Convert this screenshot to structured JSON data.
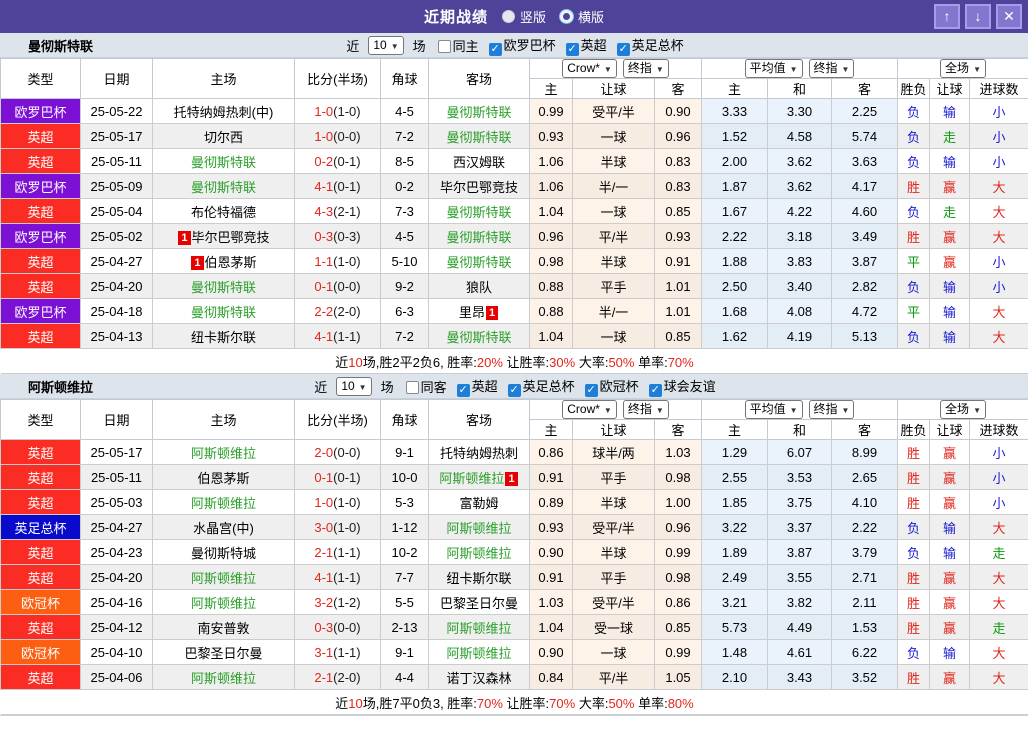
{
  "titlebar": {
    "title": "近期战绩",
    "radio_vertical": "竖版",
    "radio_horizontal": "横版",
    "icons": {
      "up": "↑",
      "down": "↓",
      "close": "✕"
    }
  },
  "accent_colors": {
    "titlebar_bg": "#4e4399",
    "button_bg": "#8376cf",
    "checkbox_blue": "#1d7fd8",
    "focus_team_green": "#2a9f2a",
    "score_red": "#e0261d"
  },
  "league_colors": {
    "欧罗巴杯": "#7c10d4",
    "英超": "#fa2c23",
    "英足总杯": "#0a0acd",
    "欧冠杯": "#fc5f11"
  },
  "result_colors": {
    "胜": "#e0261d",
    "赢": "#e0261d",
    "大": "#e0261d",
    "负": "#1a1ad0",
    "输": "#1a1ad0",
    "小": "#1a1ad0",
    "平": "#0a9a0a",
    "走": "#0a9a0a"
  },
  "table": {
    "headers": {
      "type": "类型",
      "date": "日期",
      "home": "主场",
      "score": "比分(半场)",
      "corner": "角球",
      "away": "客场",
      "bookmaker_select": "Crow*",
      "final_index_select1": "终指",
      "avg_select": "平均值",
      "final_index_select2": "终指",
      "scope_select": "全场",
      "sub": [
        "主",
        "让球",
        "客",
        "主",
        "和",
        "客",
        "胜负",
        "让球",
        "进球数"
      ]
    },
    "card_badge": "1"
  },
  "filter_labels": {
    "near": "近",
    "matches": "场",
    "count_value": "10"
  },
  "sections": [
    {
      "team": "曼彻斯特联",
      "filters": [
        {
          "label": "同主",
          "checked": false
        },
        {
          "label": "欧罗巴杯",
          "checked": true
        },
        {
          "label": "英超",
          "checked": true
        },
        {
          "label": "英足总杯",
          "checked": true
        }
      ],
      "rows": [
        {
          "league": "欧罗巴杯",
          "date": "25-05-22",
          "home": "托特纳姆热刺(中)",
          "home_focus": false,
          "home_card": "",
          "score": "1-0",
          "half": "(1-0)",
          "corner": "4-5",
          "away": "曼彻斯特联",
          "away_focus": true,
          "away_card": "",
          "h_home": "0.99",
          "handicap": "受平/半",
          "h_away": "0.90",
          "a_home": "3.33",
          "a_draw": "3.30",
          "a_away": "2.25",
          "res_wdl": "负",
          "res_handicap": "输",
          "res_goals": "小"
        },
        {
          "league": "英超",
          "date": "25-05-17",
          "home": "切尔西",
          "home_focus": false,
          "home_card": "",
          "score": "1-0",
          "half": "(0-0)",
          "corner": "7-2",
          "away": "曼彻斯特联",
          "away_focus": true,
          "away_card": "",
          "h_home": "0.93",
          "handicap": "一球",
          "h_away": "0.96",
          "a_home": "1.52",
          "a_draw": "4.58",
          "a_away": "5.74",
          "res_wdl": "负",
          "res_handicap": "走",
          "res_goals": "小"
        },
        {
          "league": "英超",
          "date": "25-05-11",
          "home": "曼彻斯特联",
          "home_focus": true,
          "home_card": "",
          "score": "0-2",
          "half": "(0-1)",
          "corner": "8-5",
          "away": "西汉姆联",
          "away_focus": false,
          "away_card": "",
          "h_home": "1.06",
          "handicap": "半球",
          "h_away": "0.83",
          "a_home": "2.00",
          "a_draw": "3.62",
          "a_away": "3.63",
          "res_wdl": "负",
          "res_handicap": "输",
          "res_goals": "小"
        },
        {
          "league": "欧罗巴杯",
          "date": "25-05-09",
          "home": "曼彻斯特联",
          "home_focus": true,
          "home_card": "",
          "score": "4-1",
          "half": "(0-1)",
          "corner": "0-2",
          "away": "毕尔巴鄂竞技",
          "away_focus": false,
          "away_card": "",
          "h_home": "1.06",
          "handicap": "半/一",
          "h_away": "0.83",
          "a_home": "1.87",
          "a_draw": "3.62",
          "a_away": "4.17",
          "res_wdl": "胜",
          "res_handicap": "赢",
          "res_goals": "大"
        },
        {
          "league": "英超",
          "date": "25-05-04",
          "home": "布伦特福德",
          "home_focus": false,
          "home_card": "",
          "score": "4-3",
          "half": "(2-1)",
          "corner": "7-3",
          "away": "曼彻斯特联",
          "away_focus": true,
          "away_card": "",
          "h_home": "1.04",
          "handicap": "一球",
          "h_away": "0.85",
          "a_home": "1.67",
          "a_draw": "4.22",
          "a_away": "4.60",
          "res_wdl": "负",
          "res_handicap": "走",
          "res_goals": "大"
        },
        {
          "league": "欧罗巴杯",
          "date": "25-05-02",
          "home": "毕尔巴鄂竞技",
          "home_focus": false,
          "home_card": "pre",
          "score": "0-3",
          "half": "(0-3)",
          "corner": "4-5",
          "away": "曼彻斯特联",
          "away_focus": true,
          "away_card": "",
          "h_home": "0.96",
          "handicap": "平/半",
          "h_away": "0.93",
          "a_home": "2.22",
          "a_draw": "3.18",
          "a_away": "3.49",
          "res_wdl": "胜",
          "res_handicap": "赢",
          "res_goals": "大"
        },
        {
          "league": "英超",
          "date": "25-04-27",
          "home": "伯恩茅斯",
          "home_focus": false,
          "home_card": "pre",
          "score": "1-1",
          "half": "(1-0)",
          "corner": "5-10",
          "away": "曼彻斯特联",
          "away_focus": true,
          "away_card": "",
          "h_home": "0.98",
          "handicap": "半球",
          "h_away": "0.91",
          "a_home": "1.88",
          "a_draw": "3.83",
          "a_away": "3.87",
          "res_wdl": "平",
          "res_handicap": "赢",
          "res_goals": "小"
        },
        {
          "league": "英超",
          "date": "25-04-20",
          "home": "曼彻斯特联",
          "home_focus": true,
          "home_card": "",
          "score": "0-1",
          "half": "(0-0)",
          "corner": "9-2",
          "away": "狼队",
          "away_focus": false,
          "away_card": "",
          "h_home": "0.88",
          "handicap": "平手",
          "h_away": "1.01",
          "a_home": "2.50",
          "a_draw": "3.40",
          "a_away": "2.82",
          "res_wdl": "负",
          "res_handicap": "输",
          "res_goals": "小"
        },
        {
          "league": "欧罗巴杯",
          "date": "25-04-18",
          "home": "曼彻斯特联",
          "home_focus": true,
          "home_card": "",
          "score": "2-2",
          "half": "(2-0)",
          "corner": "6-3",
          "away": "里昂",
          "away_focus": false,
          "away_card": "post",
          "h_home": "0.88",
          "handicap": "半/一",
          "h_away": "1.01",
          "a_home": "1.68",
          "a_draw": "4.08",
          "a_away": "4.72",
          "res_wdl": "平",
          "res_handicap": "输",
          "res_goals": "大"
        },
        {
          "league": "英超",
          "date": "25-04-13",
          "home": "纽卡斯尔联",
          "home_focus": false,
          "home_card": "",
          "score": "4-1",
          "half": "(1-1)",
          "corner": "7-2",
          "away": "曼彻斯特联",
          "away_focus": true,
          "away_card": "",
          "h_home": "1.04",
          "handicap": "一球",
          "h_away": "0.85",
          "a_home": "1.62",
          "a_draw": "4.19",
          "a_away": "5.13",
          "res_wdl": "负",
          "res_handicap": "输",
          "res_goals": "大"
        }
      ],
      "summary": [
        {
          "text": "近",
          "red": false
        },
        {
          "text": "10",
          "red": true
        },
        {
          "text": "场,胜2平2负6, 胜率:",
          "red": false
        },
        {
          "text": "20%",
          "red": true
        },
        {
          "text": " 让胜率:",
          "red": false
        },
        {
          "text": "30%",
          "red": true
        },
        {
          "text": " 大率:",
          "red": false
        },
        {
          "text": "50%",
          "red": true
        },
        {
          "text": " 单率:",
          "red": false
        },
        {
          "text": "70%",
          "red": true
        }
      ]
    },
    {
      "team": "阿斯顿维拉",
      "filters": [
        {
          "label": "同客",
          "checked": false
        },
        {
          "label": "英超",
          "checked": true
        },
        {
          "label": "英足总杯",
          "checked": true
        },
        {
          "label": "欧冠杯",
          "checked": true
        },
        {
          "label": "球会友谊",
          "checked": true
        }
      ],
      "rows": [
        {
          "league": "英超",
          "date": "25-05-17",
          "home": "阿斯顿维拉",
          "home_focus": true,
          "home_card": "",
          "score": "2-0",
          "half": "(0-0)",
          "corner": "9-1",
          "away": "托特纳姆热刺",
          "away_focus": false,
          "away_card": "",
          "h_home": "0.86",
          "handicap": "球半/两",
          "h_away": "1.03",
          "a_home": "1.29",
          "a_draw": "6.07",
          "a_away": "8.99",
          "res_wdl": "胜",
          "res_handicap": "赢",
          "res_goals": "小"
        },
        {
          "league": "英超",
          "date": "25-05-11",
          "home": "伯恩茅斯",
          "home_focus": false,
          "home_card": "",
          "score": "0-1",
          "half": "(0-1)",
          "corner": "10-0",
          "away": "阿斯顿维拉",
          "away_focus": true,
          "away_card": "post",
          "h_home": "0.91",
          "handicap": "平手",
          "h_away": "0.98",
          "a_home": "2.55",
          "a_draw": "3.53",
          "a_away": "2.65",
          "res_wdl": "胜",
          "res_handicap": "赢",
          "res_goals": "小"
        },
        {
          "league": "英超",
          "date": "25-05-03",
          "home": "阿斯顿维拉",
          "home_focus": true,
          "home_card": "",
          "score": "1-0",
          "half": "(1-0)",
          "corner": "5-3",
          "away": "富勒姆",
          "away_focus": false,
          "away_card": "",
          "h_home": "0.89",
          "handicap": "半球",
          "h_away": "1.00",
          "a_home": "1.85",
          "a_draw": "3.75",
          "a_away": "4.10",
          "res_wdl": "胜",
          "res_handicap": "赢",
          "res_goals": "小"
        },
        {
          "league": "英足总杯",
          "date": "25-04-27",
          "home": "水晶宫(中)",
          "home_focus": false,
          "home_card": "",
          "score": "3-0",
          "half": "(1-0)",
          "corner": "1-12",
          "away": "阿斯顿维拉",
          "away_focus": true,
          "away_card": "",
          "h_home": "0.93",
          "handicap": "受平/半",
          "h_away": "0.96",
          "a_home": "3.22",
          "a_draw": "3.37",
          "a_away": "2.22",
          "res_wdl": "负",
          "res_handicap": "输",
          "res_goals": "大"
        },
        {
          "league": "英超",
          "date": "25-04-23",
          "home": "曼彻斯特城",
          "home_focus": false,
          "home_card": "",
          "score": "2-1",
          "half": "(1-1)",
          "corner": "10-2",
          "away": "阿斯顿维拉",
          "away_focus": true,
          "away_card": "",
          "h_home": "0.90",
          "handicap": "半球",
          "h_away": "0.99",
          "a_home": "1.89",
          "a_draw": "3.87",
          "a_away": "3.79",
          "res_wdl": "负",
          "res_handicap": "输",
          "res_goals": "走"
        },
        {
          "league": "英超",
          "date": "25-04-20",
          "home": "阿斯顿维拉",
          "home_focus": true,
          "home_card": "",
          "score": "4-1",
          "half": "(1-1)",
          "corner": "7-7",
          "away": "纽卡斯尔联",
          "away_focus": false,
          "away_card": "",
          "h_home": "0.91",
          "handicap": "平手",
          "h_away": "0.98",
          "a_home": "2.49",
          "a_draw": "3.55",
          "a_away": "2.71",
          "res_wdl": "胜",
          "res_handicap": "赢",
          "res_goals": "大"
        },
        {
          "league": "欧冠杯",
          "date": "25-04-16",
          "home": "阿斯顿维拉",
          "home_focus": true,
          "home_card": "",
          "score": "3-2",
          "half": "(1-2)",
          "corner": "5-5",
          "away": "巴黎圣日尔曼",
          "away_focus": false,
          "away_card": "",
          "h_home": "1.03",
          "handicap": "受平/半",
          "h_away": "0.86",
          "a_home": "3.21",
          "a_draw": "3.82",
          "a_away": "2.11",
          "res_wdl": "胜",
          "res_handicap": "赢",
          "res_goals": "大"
        },
        {
          "league": "英超",
          "date": "25-04-12",
          "home": "南安普敦",
          "home_focus": false,
          "home_card": "",
          "score": "0-3",
          "half": "(0-0)",
          "corner": "2-13",
          "away": "阿斯顿维拉",
          "away_focus": true,
          "away_card": "",
          "h_home": "1.04",
          "handicap": "受一球",
          "h_away": "0.85",
          "a_home": "5.73",
          "a_draw": "4.49",
          "a_away": "1.53",
          "res_wdl": "胜",
          "res_handicap": "赢",
          "res_goals": "走"
        },
        {
          "league": "欧冠杯",
          "date": "25-04-10",
          "home": "巴黎圣日尔曼",
          "home_focus": false,
          "home_card": "",
          "score": "3-1",
          "half": "(1-1)",
          "corner": "9-1",
          "away": "阿斯顿维拉",
          "away_focus": true,
          "away_card": "",
          "h_home": "0.90",
          "handicap": "一球",
          "h_away": "0.99",
          "a_home": "1.48",
          "a_draw": "4.61",
          "a_away": "6.22",
          "res_wdl": "负",
          "res_handicap": "输",
          "res_goals": "大"
        },
        {
          "league": "英超",
          "date": "25-04-06",
          "home": "阿斯顿维拉",
          "home_focus": true,
          "home_card": "",
          "score": "2-1",
          "half": "(2-0)",
          "corner": "4-4",
          "away": "诺丁汉森林",
          "away_focus": false,
          "away_card": "",
          "h_home": "0.84",
          "handicap": "平/半",
          "h_away": "1.05",
          "a_home": "2.10",
          "a_draw": "3.43",
          "a_away": "3.52",
          "res_wdl": "胜",
          "res_handicap": "赢",
          "res_goals": "大"
        }
      ],
      "summary": [
        {
          "text": "近",
          "red": false
        },
        {
          "text": "10",
          "red": true
        },
        {
          "text": "场,胜7平0负3, 胜率:",
          "red": false
        },
        {
          "text": "70%",
          "red": true
        },
        {
          "text": " 让胜率:",
          "red": false
        },
        {
          "text": "70%",
          "red": true
        },
        {
          "text": " 大率:",
          "red": false
        },
        {
          "text": "50%",
          "red": true
        },
        {
          "text": " 单率:",
          "red": false
        },
        {
          "text": "80%",
          "red": true
        }
      ]
    }
  ]
}
